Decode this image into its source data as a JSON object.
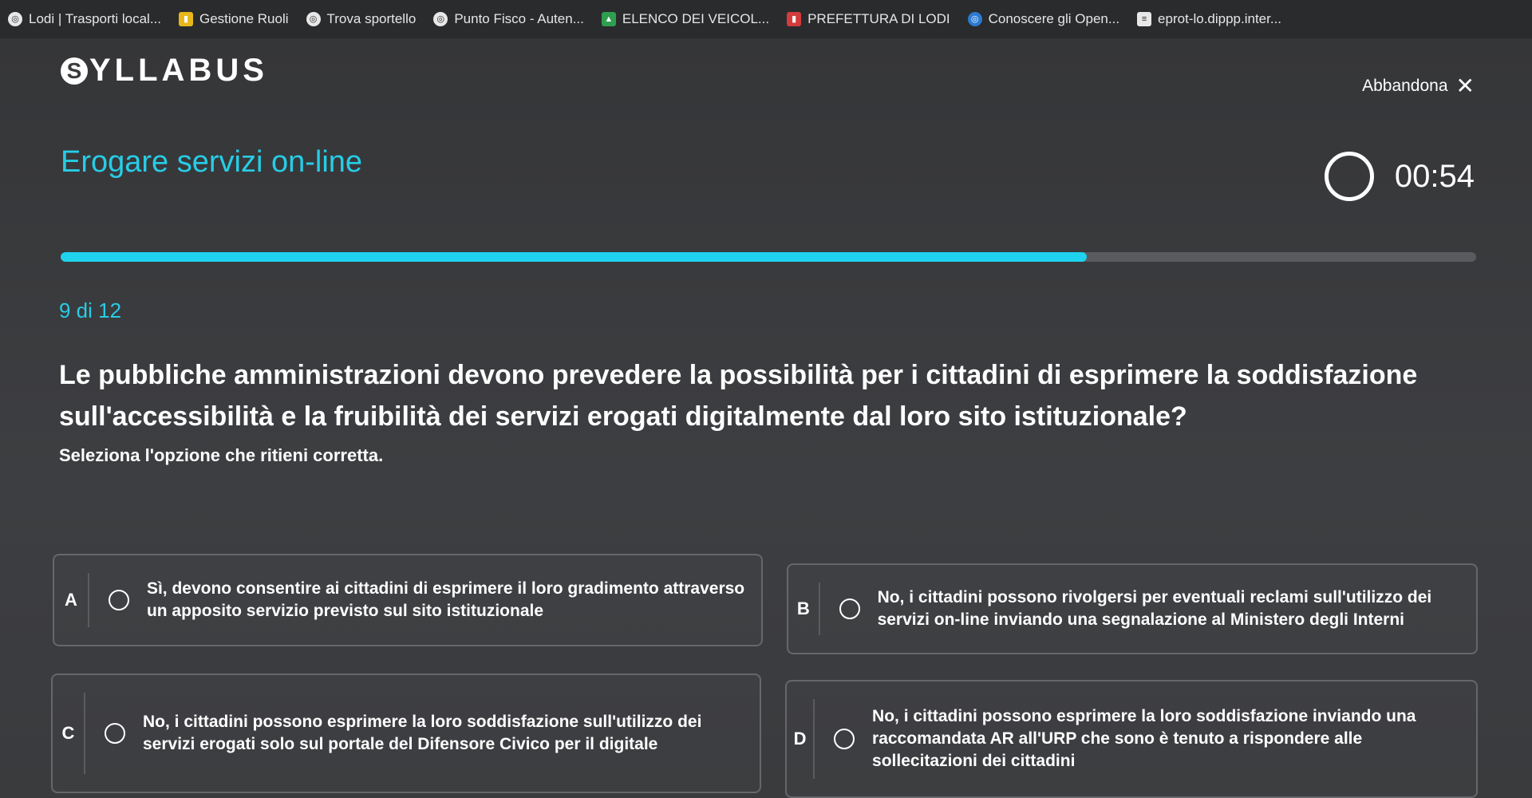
{
  "bookmarks": [
    {
      "label": "Lodi | Trasporti local...",
      "icon": "globe-icon"
    },
    {
      "label": "Gestione Ruoli",
      "icon": "bookmark-icon"
    },
    {
      "label": "Trova sportello",
      "icon": "globe-icon"
    },
    {
      "label": "Punto Fisco - Auten...",
      "icon": "globe-icon"
    },
    {
      "label": "ELENCO DEI VEICOL...",
      "icon": "vehicle-icon"
    },
    {
      "label": "PREFETTURA DI LODI",
      "icon": "flag-icon"
    },
    {
      "label": "Conoscere gli Open...",
      "icon": "globe-icon"
    },
    {
      "label": "eprot-lo.dippp.inter...",
      "icon": "document-icon"
    }
  ],
  "header": {
    "logo": "YLLABUS",
    "logo_initial": "S",
    "abandon_label": "Abbandona",
    "close_glyph": "✕"
  },
  "course": {
    "title": "Erogare servizi on-line"
  },
  "timer": {
    "value": "00:54"
  },
  "progress": {
    "current": 9,
    "total": 12,
    "fraction": 0.725,
    "label": "9 di 12"
  },
  "question": {
    "text": "Le pubbliche amministrazioni devono prevedere la possibilità per i cittadini di esprimere la soddisfazione sull'accessibilità e la fruibilità dei servizi erogati digitalmente dal loro sito istituzionale?",
    "instruction": "Seleziona l'opzione che ritieni corretta."
  },
  "options": [
    {
      "letter": "A",
      "text": "Sì, devono consentire ai cittadini di esprimere il loro gradimento attraverso un apposito servizio previsto sul sito istituzionale"
    },
    {
      "letter": "B",
      "text": "No, i cittadini possono rivolgersi per eventuali reclami sull'utilizzo dei servizi on-line inviando una segnalazione al Ministero degli Interni"
    },
    {
      "letter": "C",
      "text": "No, i cittadini possono esprimere la loro soddisfazione sull'utilizzo dei servizi erogati solo sul portale del Difensore Civico per il digitale"
    },
    {
      "letter": "D",
      "text": "No, i cittadini possono esprimere la loro soddisfazione inviando una raccomandata AR all'URP che sono è tenuto a rispondere alle sollecitazioni dei cittadini"
    }
  ],
  "colors": {
    "accent": "#1fd3ee",
    "background": "#3a3b3d"
  }
}
